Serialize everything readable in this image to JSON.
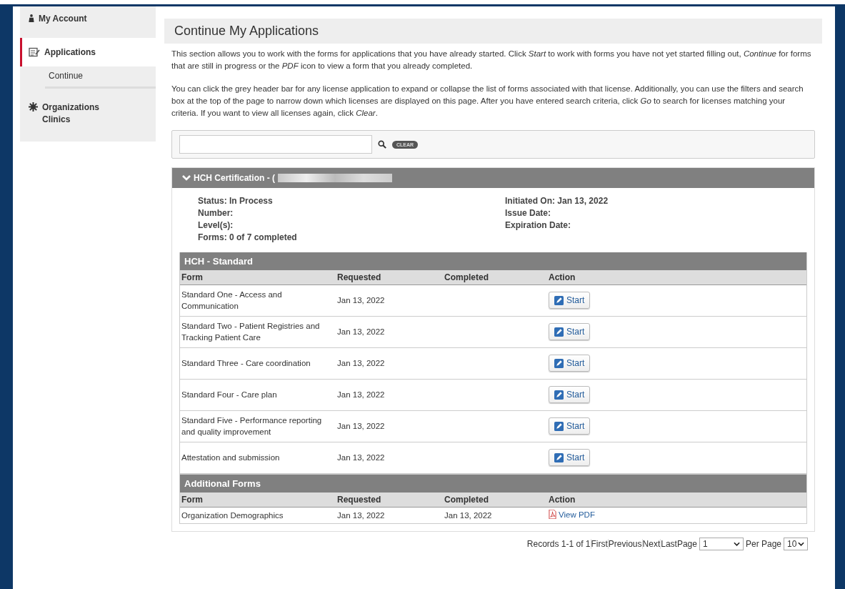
{
  "sidebar": {
    "items": [
      {
        "label": "My Account",
        "selected": false
      },
      {
        "label": "Applications",
        "selected": true,
        "children": [
          {
            "label": "Continue",
            "selected": false
          }
        ]
      },
      {
        "label": "Organizations Clinics",
        "selected": false
      }
    ]
  },
  "main": {
    "title": "Continue My Applications",
    "paragraphs": [
      "This section allows you to work with the forms for applications that you have already started. Click *Start* to work with forms you have not yet started filling out, *Continue* for forms that are still in progress or the *PDF* icon to view a form that you already completed.",
      "You can click the grey header bar for any license application to expand or collapse the list of forms associated with that license. Additionally, you can use the filters and search box at the top of the page to narrow down which licenses are displayed on this page. After you have entered search criteria, click *Go* to search for licenses matching your criteria. If you want to view all licenses again, click *Clear*."
    ],
    "search": {
      "clear_label": "CLEAR"
    },
    "license": {
      "title": "HCH Certification - (",
      "expanded": true,
      "details_left": [
        "Status: In Process",
        "Number:",
        "Level(s):",
        "Forms: 0 of 7 completed"
      ],
      "details_right": [
        "Initiated On: Jan 13, 2022",
        "Issue Date:",
        "Expiration Date:"
      ],
      "sections": [
        {
          "title": "HCH - Standard",
          "columns": [
            "Form",
            "Requested",
            "Completed",
            "Action"
          ],
          "rows": [
            {
              "form": "Standard One - Access and Communication",
              "requested": "Jan 13, 2022",
              "action": {
                "kind": "start",
                "label": "Start"
              }
            },
            {
              "form": "Standard Two - Patient Registries and Tracking Patient Care",
              "requested": "Jan 13, 2022",
              "action": {
                "kind": "start",
                "label": "Start"
              }
            },
            {
              "form": "Standard Three - Care coordination",
              "requested": "Jan 13, 2022",
              "action": {
                "kind": "start",
                "label": "Start"
              }
            },
            {
              "form": "Standard Four - Care plan",
              "requested": "Jan 13, 2022",
              "action": {
                "kind": "start",
                "label": "Start"
              }
            },
            {
              "form": "Standard Five - Performance reporting and quality improvement",
              "requested": "Jan 13, 2022",
              "action": {
                "kind": "start",
                "label": "Start"
              }
            },
            {
              "form": "Attestation and submission",
              "requested": "Jan 13, 2022",
              "action": {
                "kind": "start",
                "label": "Start"
              }
            }
          ]
        },
        {
          "title": "Additional Forms",
          "columns": [
            "Form",
            "Requested",
            "Completed",
            "Action"
          ],
          "rows": [
            {
              "form": "Organization Demographics",
              "requested": "Jan 13, 2022",
              "completed": "Jan 13, 2022",
              "action": {
                "kind": "pdf",
                "label": "View PDF"
              }
            }
          ]
        }
      ]
    },
    "pagination": {
      "records": "Records 1-1 of 1",
      "links": [
        "First",
        "Previous",
        "Next",
        "Last"
      ],
      "page_label": "Page",
      "page_value": "1",
      "per_page_label": "Per Page",
      "per_page_value": "10"
    }
  }
}
